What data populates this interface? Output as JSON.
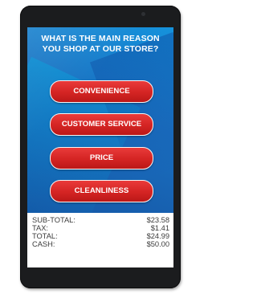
{
  "question": {
    "line1": "WHAT IS THE MAIN REASON",
    "line2": "YOU SHOP AT OUR STORE?"
  },
  "options": [
    {
      "label": "CONVENIENCE"
    },
    {
      "label": "CUSTOMER SERVICE"
    },
    {
      "label": "PRICE"
    },
    {
      "label": "CLEANLINESS"
    }
  ],
  "totals": [
    {
      "label": "SUB-TOTAL:",
      "value": "$23.58"
    },
    {
      "label": "TAX:",
      "value": "$1.41"
    },
    {
      "label": "TOTAL:",
      "value": "$24.99"
    },
    {
      "label": "CASH:",
      "value": "$50.00"
    }
  ],
  "colors": {
    "button": "#d42423",
    "screen_background": "#1d7fd0",
    "device_frame": "#1b1c1e"
  }
}
